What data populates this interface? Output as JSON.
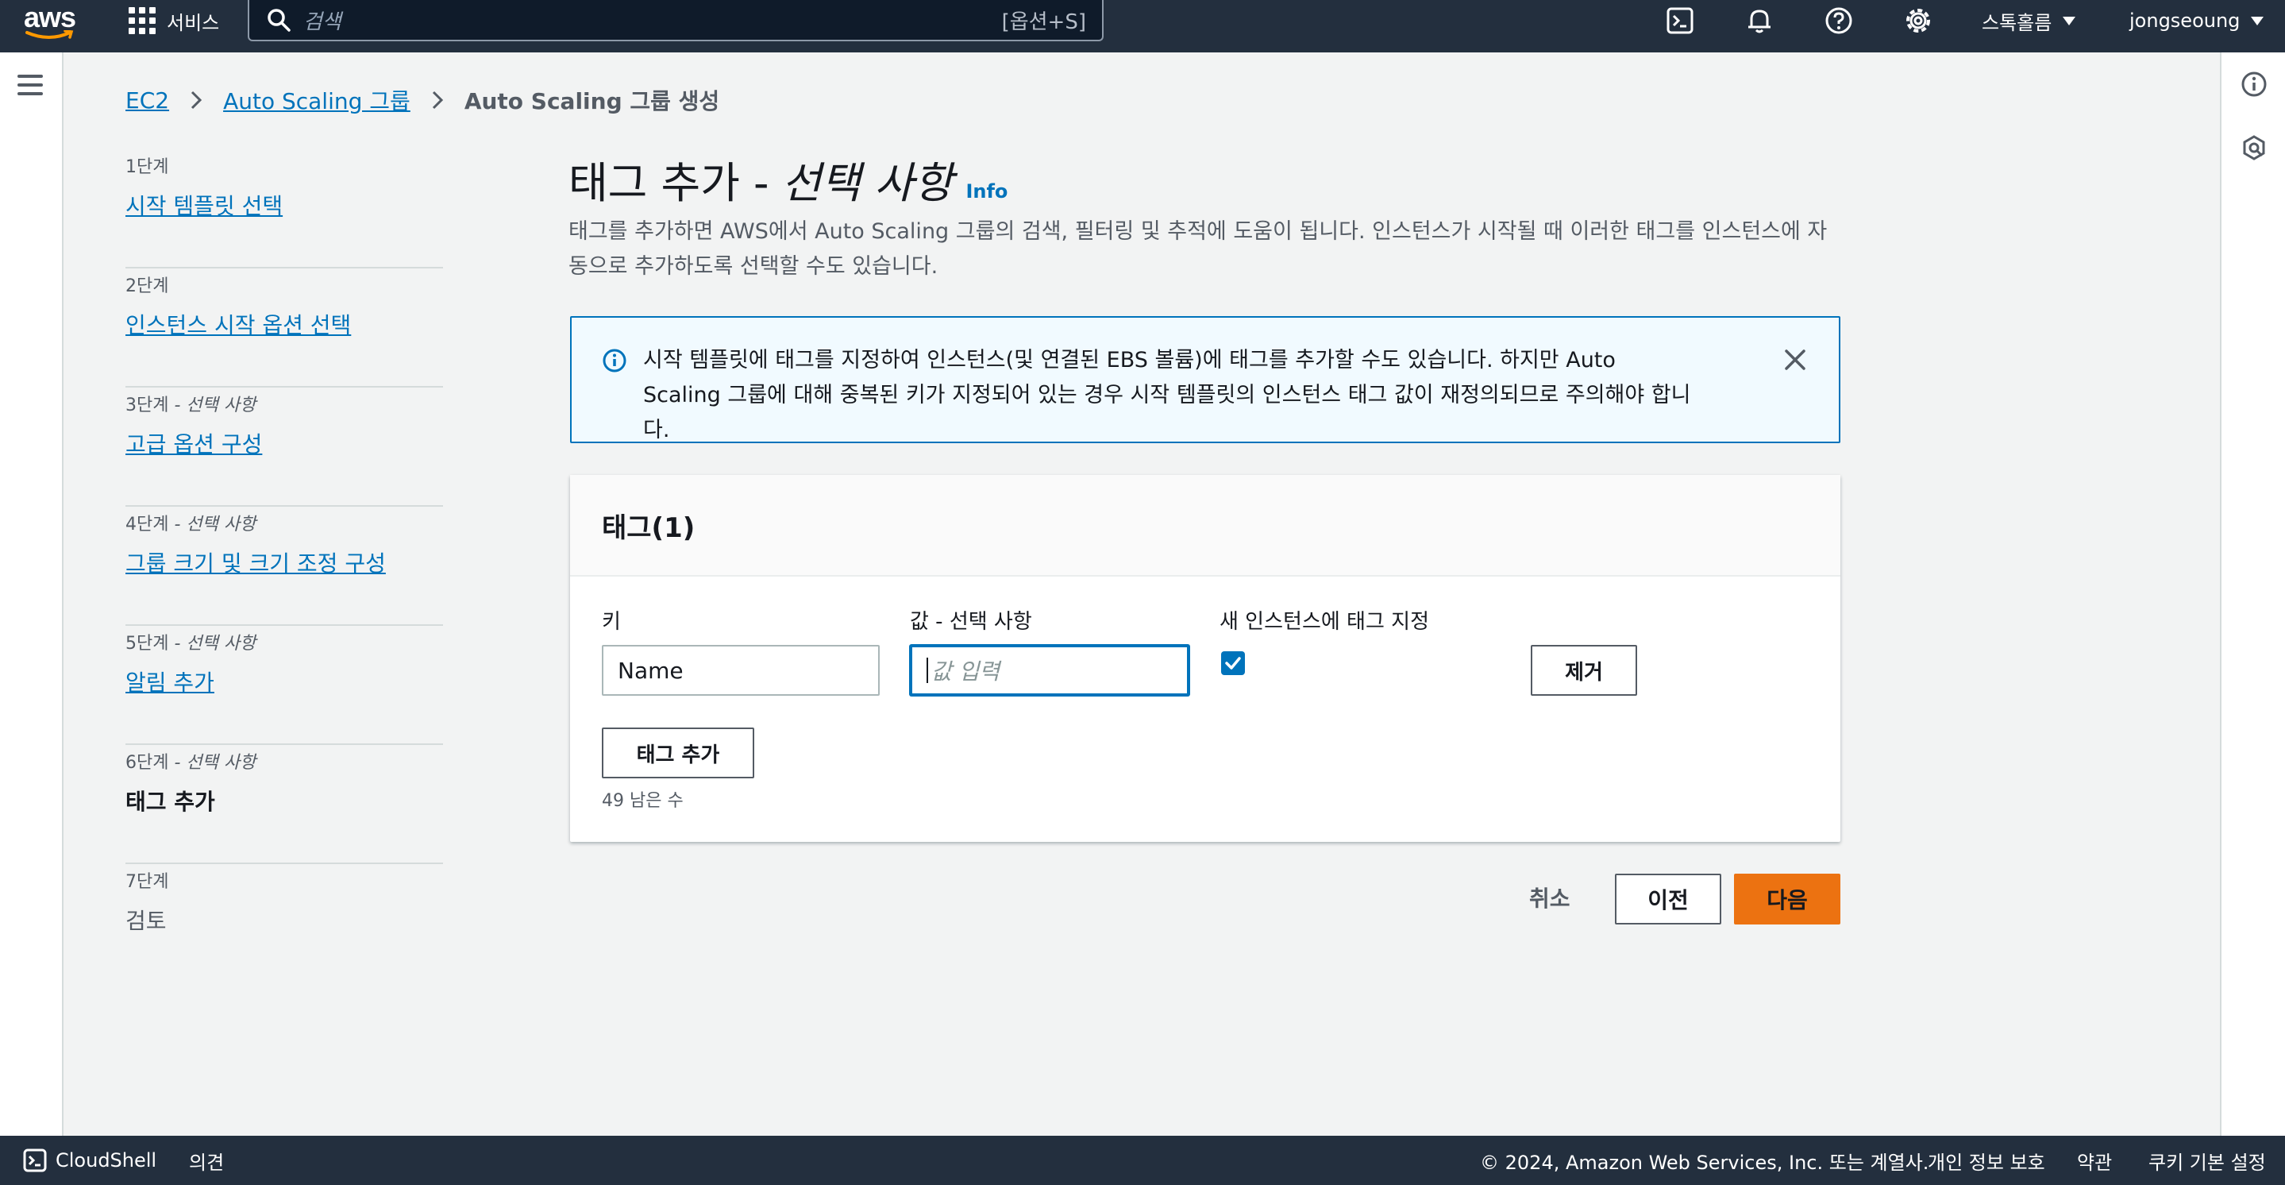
{
  "topnav": {
    "logo_text": "aws",
    "services_label": "서비스",
    "search_placeholder": "검색",
    "search_shortcut": "[옵션+S]",
    "region": "스톡홀름",
    "user": "jongseoung"
  },
  "breadcrumb": {
    "items": [
      "EC2",
      "Auto Scaling 그룹"
    ],
    "current": "Auto Scaling 그룹 생성"
  },
  "steps": [
    {
      "num": "1단계",
      "optional": "",
      "name": "시작 템플릿 선택",
      "state": "link"
    },
    {
      "num": "2단계",
      "optional": "",
      "name": "인스턴스 시작 옵션 선택",
      "state": "link"
    },
    {
      "num": "3단계",
      "optional": "- 선택 사항",
      "name": "고급 옵션 구성",
      "state": "link"
    },
    {
      "num": "4단계",
      "optional": "- 선택 사항",
      "name": "그룹 크기 및 크기 조정 구성",
      "state": "link"
    },
    {
      "num": "5단계",
      "optional": "- 선택 사항",
      "name": "알림 추가",
      "state": "link"
    },
    {
      "num": "6단계",
      "optional": "- 선택 사항",
      "name": "태그 추가",
      "state": "active"
    },
    {
      "num": "7단계",
      "optional": "",
      "name": "검토",
      "state": "disabled"
    }
  ],
  "main": {
    "title": "태그 추가 -",
    "title_optional": "선택 사항",
    "info": "Info",
    "description": "태그를 추가하면 AWS에서 Auto Scaling 그룹의 검색, 필터링 및 추적에 도움이 됩니다. 인스턴스가 시작될 때 이러한 태그를 인스턴스에 자동으로 추가하도록 선택할 수도 있습니다."
  },
  "alert": {
    "text": "시작 템플릿에 태그를 지정하여 인스턴스(및 연결된 EBS 볼륨)에 태그를 추가할 수도 있습니다. 하지만 Auto Scaling 그룹에 대해 중복된 키가 지정되어 있는 경우 시작 템플릿의 인스턴스 태그 값이 재정의되므로 주의해야 합니다."
  },
  "tags_panel": {
    "header": "태그(1)",
    "key_label": "키",
    "value_label": "값 - 선택 사항",
    "tag_new_label": "새 인스턴스에 태그 지정",
    "key_value": "Name",
    "value_placeholder": "값 입력",
    "tag_new_checked": true,
    "remove_label": "제거",
    "add_tag_label": "태그 추가",
    "remaining": "49 남은 수"
  },
  "actions": {
    "cancel": "취소",
    "previous": "이전",
    "next": "다음"
  },
  "bottombar": {
    "cloudshell": "CloudShell",
    "feedback": "의견",
    "copyright": "© 2024, Amazon Web Services, Inc. 또는 계열사.",
    "privacy": "개인 정보 보호",
    "terms": "약관",
    "cookies": "쿠키 기본 설정"
  },
  "colors": {
    "nav_bg": "#232f3e",
    "link": "#0073bb",
    "primary": "#ec7211"
  }
}
